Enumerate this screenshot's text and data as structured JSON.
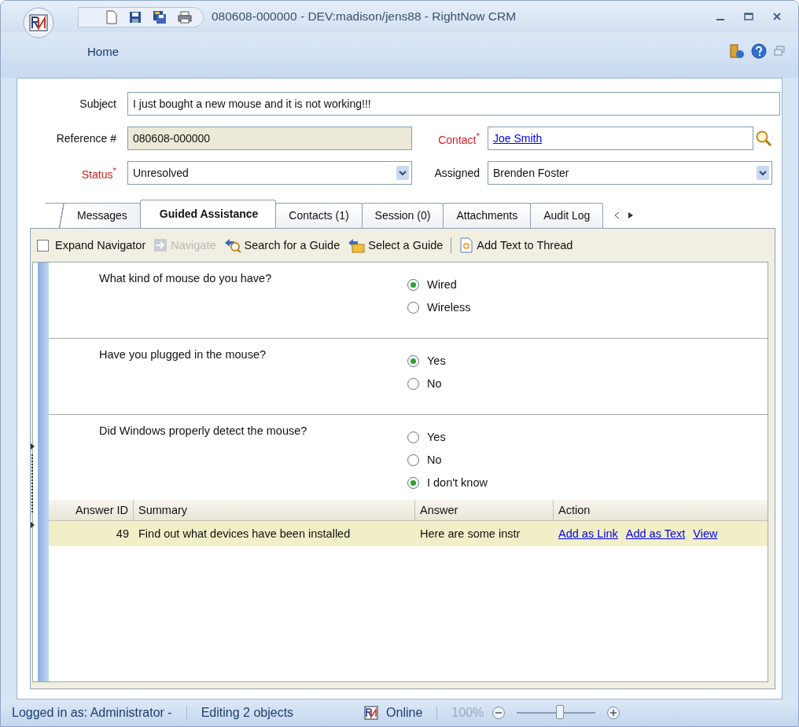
{
  "window": {
    "title": "080608-000000  - DEV:madison/jens88 - RightNow CRM"
  },
  "ribbon": {
    "tab": "Home"
  },
  "form": {
    "subject": {
      "label": "Subject",
      "value": "I just bought a new mouse and it is not working!!!"
    },
    "reference": {
      "label": "Reference #",
      "value": "080608-000000"
    },
    "contact": {
      "label": "Contact$^{*}$",
      "required": true,
      "value": "Joe Smith"
    },
    "status": {
      "label": "Status$^{*}$",
      "required": true,
      "value": "Unresolved"
    },
    "assigned": {
      "label": "Assigned",
      "required": false,
      "value": "Brenden Foster"
    }
  },
  "tabs": [
    {
      "label": "Messages",
      "selected": false
    },
    {
      "label": "Guided Assistance",
      "selected": true
    },
    {
      "label": "Contacts (1)",
      "selected": false
    },
    {
      "label": "Session (0)",
      "selected": false
    },
    {
      "label": "Attachments",
      "selected": false
    },
    {
      "label": "Audit Log",
      "selected": false
    }
  ],
  "toolbar": [
    {
      "kind": "checkbox",
      "label": "Expand Navigator",
      "checked": false
    },
    {
      "kind": "button",
      "label": "Navigate",
      "disabled": true
    },
    {
      "kind": "button",
      "label": "Search for a Guide",
      "disabled": false
    },
    {
      "kind": "button",
      "label": "Select a Guide",
      "disabled": false
    },
    {
      "kind": "separator"
    },
    {
      "kind": "button",
      "label": "Add Text to Thread",
      "disabled": false
    }
  ],
  "questions": [
    {
      "text": "What kind of mouse do you have?",
      "options": [
        {
          "label": "Wired",
          "selected": true
        },
        {
          "label": "Wireless",
          "selected": false
        }
      ]
    },
    {
      "text": "Have you plugged in the mouse?",
      "options": [
        {
          "label": "Yes",
          "selected": true
        },
        {
          "label": "No",
          "selected": false
        }
      ]
    },
    {
      "text": "Did Windows properly detect the mouse?",
      "options": [
        {
          "label": "Yes",
          "selected": false
        },
        {
          "label": "No",
          "selected": false
        },
        {
          "label": "I don't know",
          "selected": true
        }
      ]
    }
  ],
  "answers": {
    "columns": [
      "Answer ID",
      "Summary",
      "Answer",
      "Action"
    ],
    "rows": [
      {
        "id": "49",
        "summary": "Find out what devices have been installed",
        "answer": "Here are some instr",
        "actions": [
          "Add as Link",
          "Add as Text",
          "View"
        ]
      }
    ]
  },
  "status_bar": {
    "user": "Logged in as: Administrator -",
    "editing": "Editing 2 objects",
    "connection": "Online",
    "zoom": "100%",
    "zoom_slider": {
      "level": 0.55
    }
  }
}
